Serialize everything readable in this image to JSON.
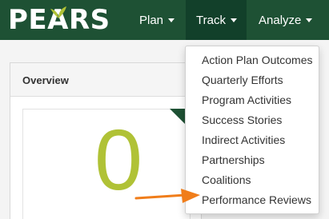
{
  "brand": {
    "logo_text": "PEARS"
  },
  "nav": {
    "plan_label": "Plan",
    "track_label": "Track",
    "analyze_label": "Analyze"
  },
  "overview": {
    "title": "Overview",
    "count": "0"
  },
  "track_menu": {
    "items": [
      {
        "label": "Action Plan Outcomes"
      },
      {
        "label": "Quarterly Efforts"
      },
      {
        "label": "Program Activities"
      },
      {
        "label": "Success Stories"
      },
      {
        "label": "Indirect Activities"
      },
      {
        "label": "Partnerships"
      },
      {
        "label": "Coalitions"
      },
      {
        "label": "Performance Reviews"
      }
    ]
  },
  "colors": {
    "navbar": "#1e5134",
    "navbar_active": "#12402a",
    "accent_number": "#b0c236",
    "arrow": "#f07d1a"
  }
}
